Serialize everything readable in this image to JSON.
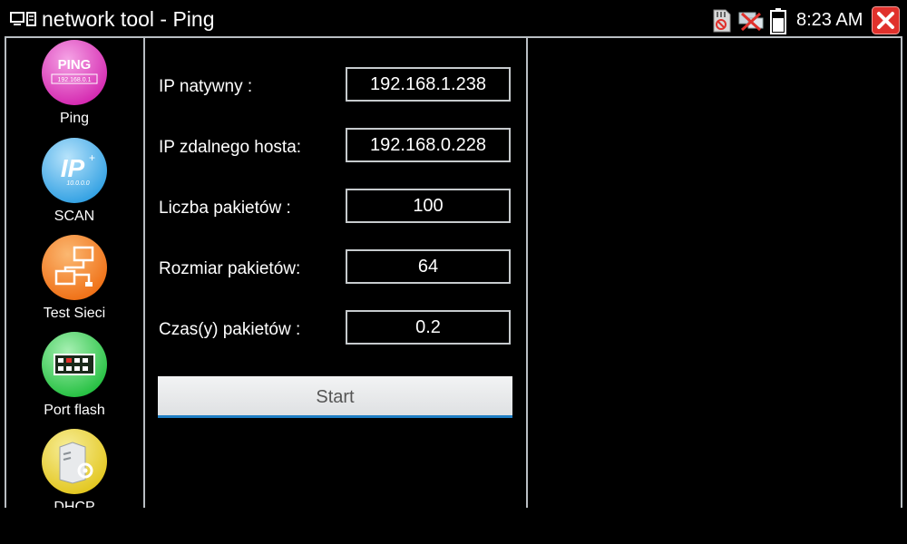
{
  "titlebar": {
    "title": "network tool - Ping",
    "clock": "8:23 AM",
    "icons": [
      "network-tool-icon",
      "sd-card-icon",
      "network-disconnected-icon",
      "battery-icon",
      "close-icon"
    ]
  },
  "sidebar": {
    "items": [
      {
        "label": "Ping",
        "icon": "ping-icon",
        "icon_text": "PING",
        "icon_subtext": "192.168.0.1",
        "color": "#e02fb9"
      },
      {
        "label": "SCAN",
        "icon": "ip-scan-icon",
        "icon_text": "IP",
        "icon_subtext": "10.0.0.0",
        "color": "#39a8e8"
      },
      {
        "label": "Test Sieci",
        "icon": "network-test-icon",
        "color": "#f47a1e"
      },
      {
        "label": "Port flash",
        "icon": "port-flash-icon",
        "color": "#2fc84a"
      },
      {
        "label": "DHCP",
        "icon": "dhcp-server-icon",
        "color": "#e8d02a"
      }
    ]
  },
  "form": {
    "local_ip_label": "IP natywny :",
    "local_ip_value": "192.168.1.238",
    "remote_ip_label": "IP zdalnego hosta:",
    "remote_ip_value": "192.168.0.228",
    "packet_count_label": "Liczba pakietów :",
    "packet_count_value": "100",
    "packet_size_label": "Rozmiar pakietów:",
    "packet_size_value": "64",
    "packet_time_label": "Czas(y) pakietów :",
    "packet_time_value": "0.2",
    "start_label": "Start"
  },
  "colors": {
    "accent": "#1f7fc4",
    "close": "#e0312c",
    "frame": "#b9bec3"
  }
}
